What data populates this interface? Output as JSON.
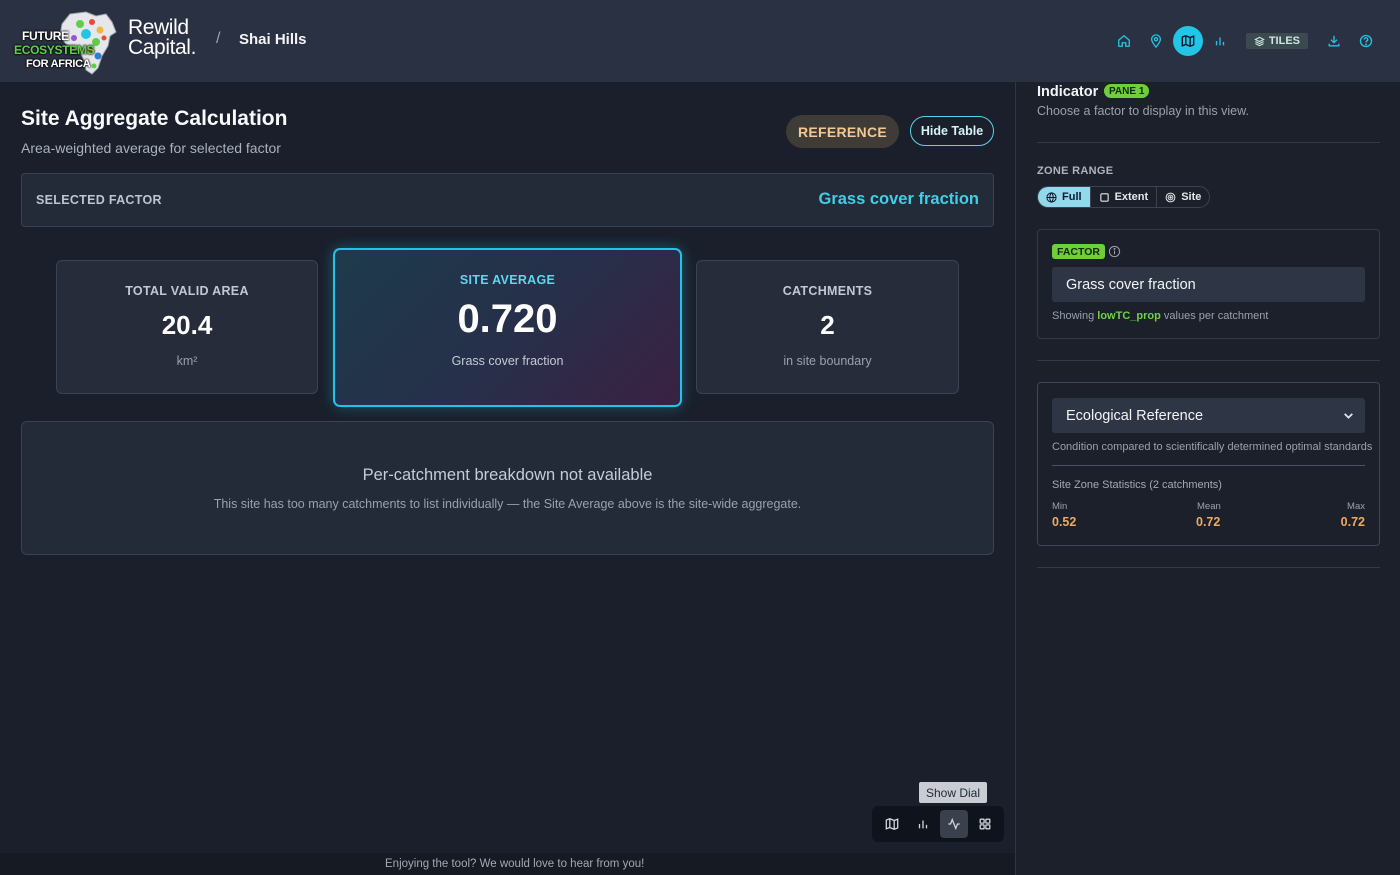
{
  "header": {
    "logo_line1": "FUTURE",
    "logo_line2": "ECOSYSTEMS",
    "logo_line3": "FOR AFRICA",
    "brand_line1": "Rewild",
    "brand_line2": "Capital.",
    "separator": "/",
    "site_name": "Shai Hills",
    "tiles_label": "TILES"
  },
  "main": {
    "title": "Site Aggregate Calculation",
    "subtitle": "Area-weighted average for selected factor",
    "reference_badge": "REFERENCE",
    "hide_table_label": "Hide Table",
    "selected_factor_label": "SELECTED FACTOR",
    "selected_factor_value": "Grass cover fraction",
    "stats": {
      "total_area": {
        "label": "TOTAL VALID AREA",
        "value": "20.4",
        "sub": "km²"
      },
      "site_average": {
        "label": "SITE AVERAGE",
        "value": "0.720",
        "sub": "Grass cover fraction"
      },
      "catchments": {
        "label": "CATCHMENTS",
        "value": "2",
        "sub": "in site boundary"
      }
    },
    "breakdown": {
      "title": "Per-catchment breakdown not available",
      "text": "This site has too many catchments to list individually — the Site Average above is the site-wide aggregate."
    },
    "show_dial_label": "Show Dial"
  },
  "footer": {
    "text": "Enjoying the tool? We would love to hear from you!"
  },
  "sidebar": {
    "indicator_title": "Indicator",
    "pane_badge": "PANE 1",
    "indicator_subtitle": "Choose a factor to display in this view.",
    "zone_range_label": "ZONE RANGE",
    "zone_range_options": [
      "Full",
      "Extent",
      "Site"
    ],
    "factor_tag": "FACTOR",
    "factor_selected": "Grass cover fraction",
    "factor_note_prefix": "Showing",
    "factor_note_field": "lowTC_prop",
    "factor_note_suffix": "values per catchment",
    "reference_selected": "Ecological Reference",
    "reference_desc": "Condition compared to scientifically determined optimal standards",
    "zone_stats_title": "Site Zone Statistics (2 catchments)",
    "zone_stats": {
      "min_label": "Min",
      "min_value": "0.52",
      "mean_label": "Mean",
      "mean_value": "0.72",
      "max_label": "Max",
      "max_value": "0.72"
    }
  },
  "colors": {
    "accent": "#22c5e6",
    "badge_green": "#6fcf3a",
    "stat_orange": "#f0a962",
    "reference_text": "#f3c892"
  },
  "icons": [
    "home-icon",
    "location-pin-icon",
    "map-icon",
    "bar-chart-icon",
    "layers-icon",
    "download-icon",
    "help-icon",
    "globe-icon",
    "square-icon",
    "target-icon",
    "info-icon",
    "chevron-down-icon",
    "activity-icon",
    "grid-icon"
  ]
}
